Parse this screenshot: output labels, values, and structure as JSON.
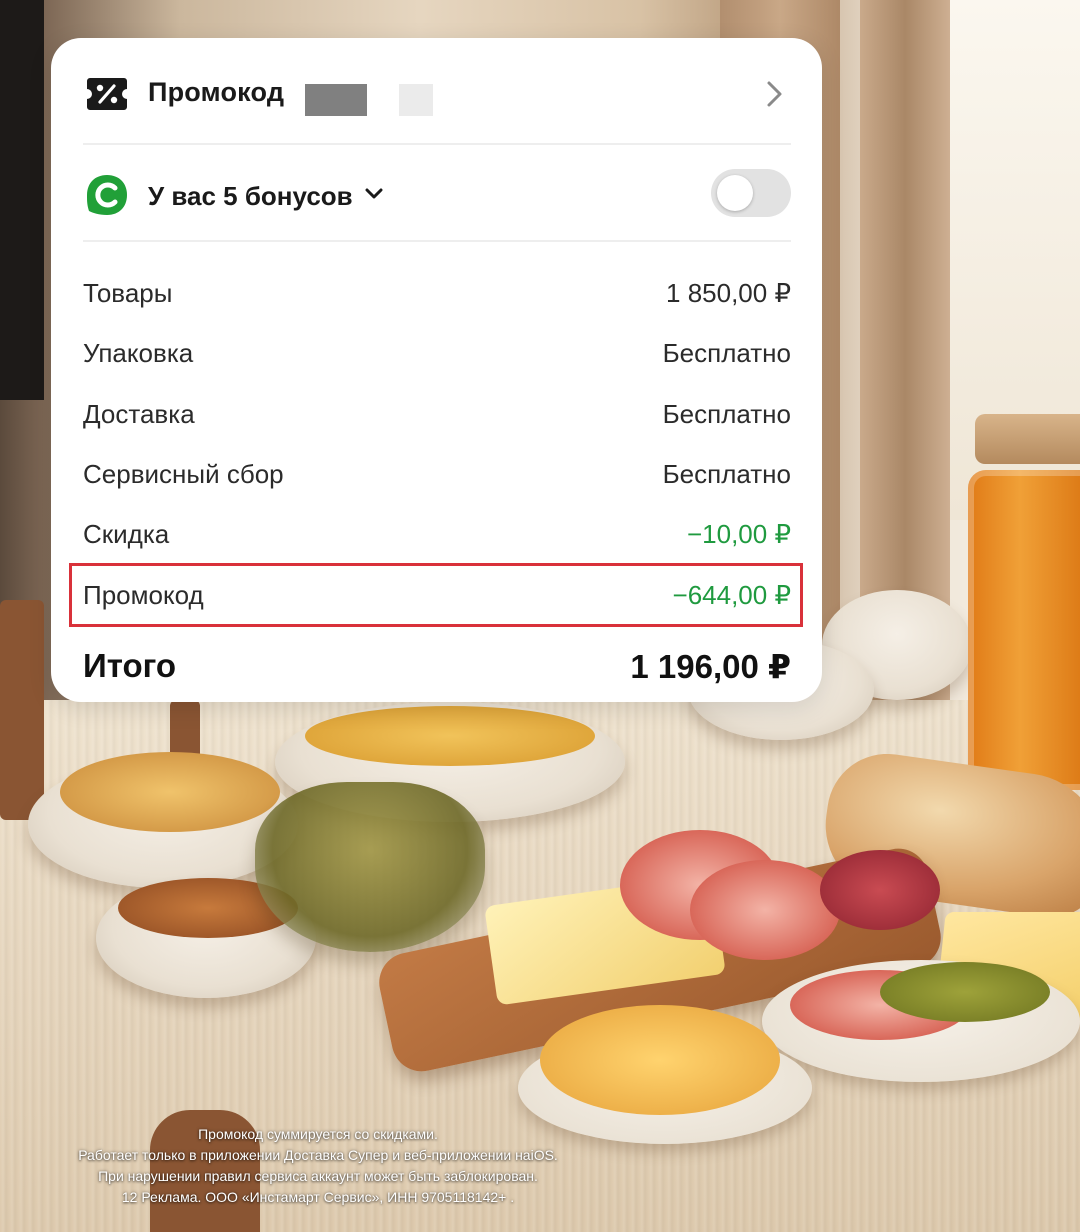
{
  "promo_row": {
    "title": "Промокод",
    "icon": "promo-percent-icon",
    "chevron": "chevron-right-icon"
  },
  "bonus_row": {
    "label": "У вас 5 бонусов",
    "icon": "bonus-c-icon",
    "toggle_on": false,
    "accent_color": "#21a038"
  },
  "summary": {
    "items": [
      {
        "label": "Товары",
        "value": "1 850,00 ₽"
      },
      {
        "label": "Упаковка",
        "value": "Бесплатно"
      },
      {
        "label": "Доставка",
        "value": "Бесплатно"
      },
      {
        "label": "Сервисный сбор",
        "value": "Бесплатно"
      },
      {
        "label": "Скидка",
        "value": "−10,00 ₽"
      },
      {
        "label": "Промокод",
        "value": "−644,00 ₽"
      }
    ],
    "total_label": "Итого",
    "total_value": "1 196,00 ₽",
    "discount_color": "#1f9a3f",
    "highlight_color": "#d9313a"
  },
  "footer": {
    "line1": "Промокод суммируется со скидками.",
    "line2": "Работает только в приложении Доставка Супер и веб-приложении наiOS.",
    "line3": "При нарушении правил сервиса аккаунт может быть заблокирован.",
    "line4": "12  Реклама. ООО «Инстамарт Сервис», ИНН 9705118142+ ."
  }
}
